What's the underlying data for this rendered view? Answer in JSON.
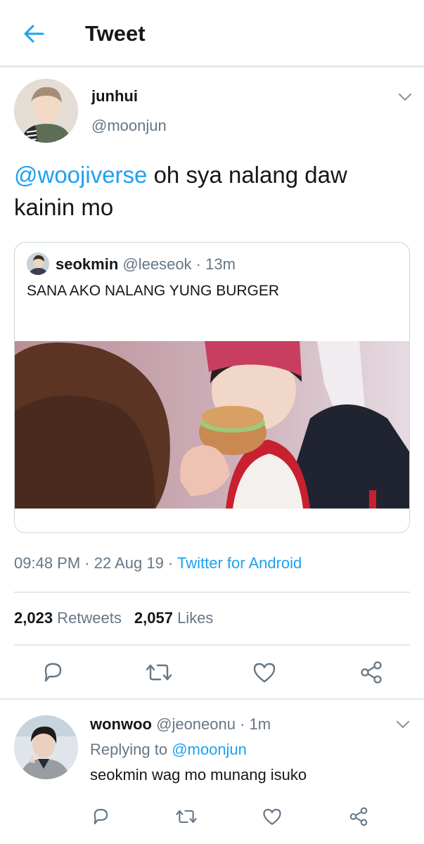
{
  "header": {
    "title": "Tweet"
  },
  "tweet": {
    "author_name": "junhui",
    "author_handle": "@moonjun",
    "text_mention": "@woojiverse",
    "text_body": " oh sya nalang daw kainin mo",
    "quote": {
      "name": "seokmin",
      "handle": "@leeseok",
      "time": " · 13m",
      "text": "SANA AKO NALANG YUNG BURGER"
    },
    "time": "09:48 PM",
    "date": " · 22 Aug 19 · ",
    "source": "Twitter for Android",
    "retweets_count": "2,023",
    "retweets_label": " Retweets",
    "likes_count": "2,057",
    "likes_label": " Likes"
  },
  "reply": {
    "name": "wonwoo",
    "handle": "@jeoneonu",
    "time": " · 1m",
    "replying_prefix": "Replying to ",
    "replying_to": "@moonjun",
    "text": "seokmin wag mo munang isuko"
  },
  "colors": {
    "accent": "#1da1f2",
    "text_primary": "#14171a",
    "text_secondary": "#657786",
    "divider": "#e1e8ed"
  }
}
